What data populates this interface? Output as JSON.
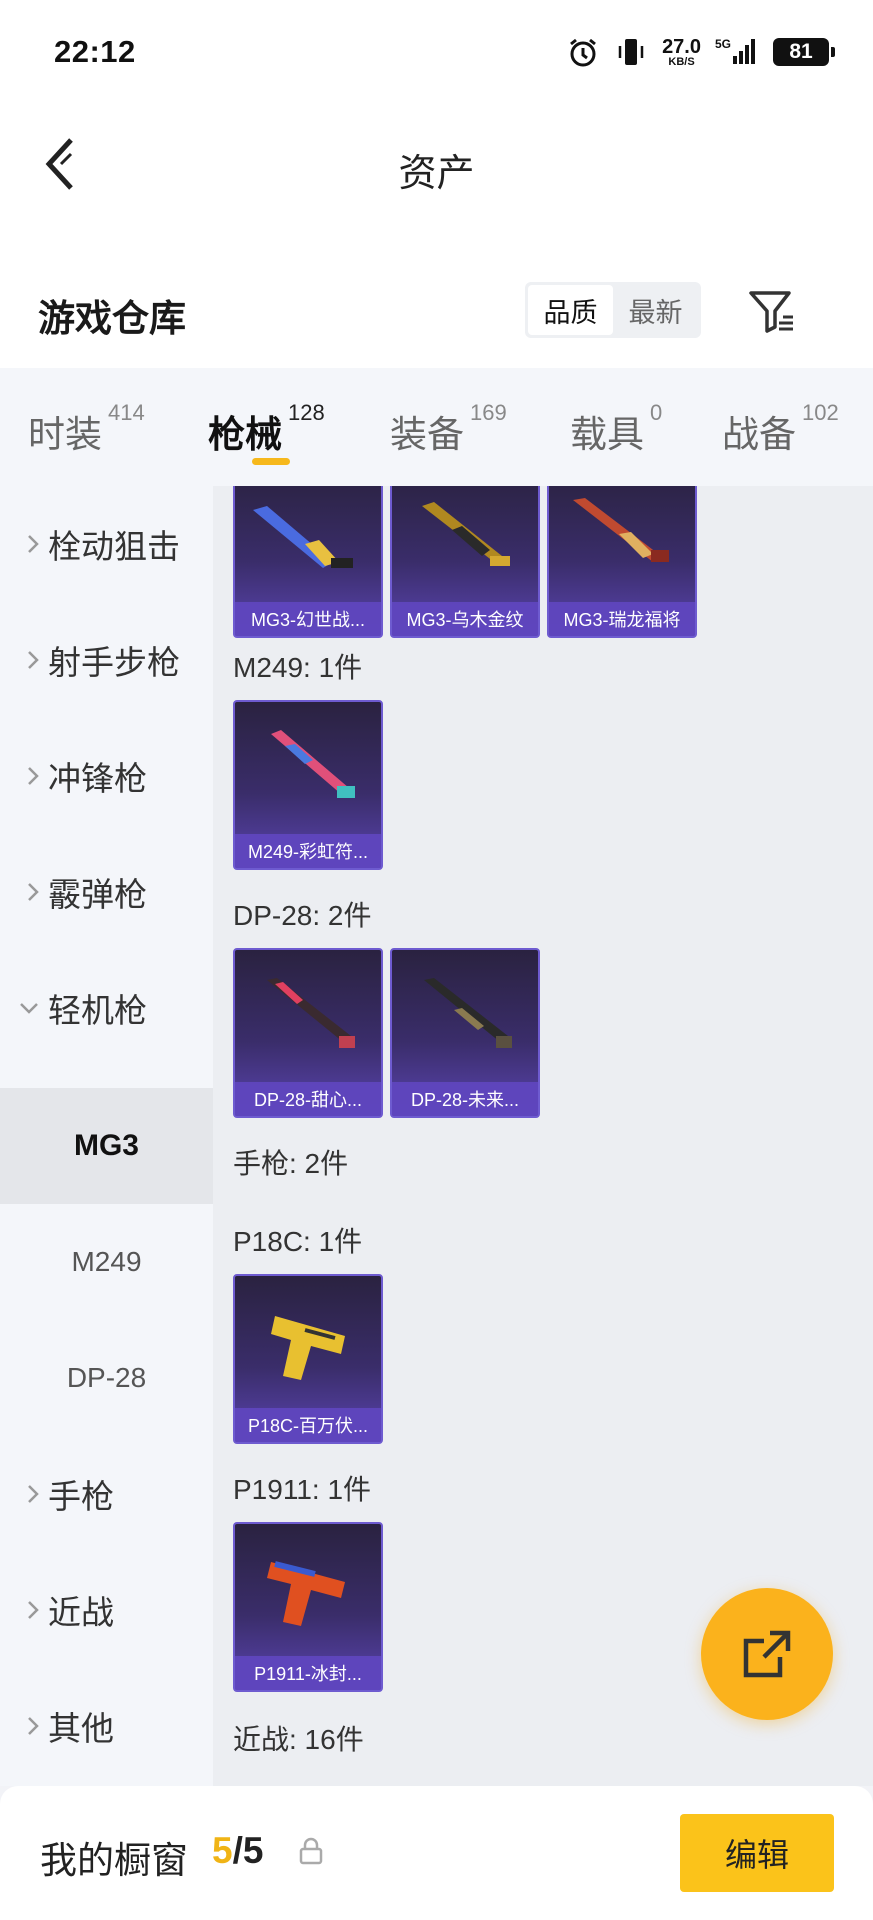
{
  "status_bar": {
    "time": "22:12",
    "speed_value": "27.0",
    "speed_unit": "KB/S",
    "network": "5G",
    "battery": "81"
  },
  "header": {
    "title": "资产"
  },
  "warehouse": {
    "title": "游戏仓库",
    "sort_options": [
      "品质",
      "最新"
    ],
    "active_sort": "品质"
  },
  "tabs": [
    {
      "label": "时装",
      "count": "414"
    },
    {
      "label": "枪械",
      "count": "128"
    },
    {
      "label": "装备",
      "count": "169"
    },
    {
      "label": "载具",
      "count": "0"
    },
    {
      "label": "战备",
      "count": "102"
    }
  ],
  "active_tab": "枪械",
  "sidebar": {
    "items": [
      "栓动狙击",
      "射手步枪",
      "冲锋枪",
      "霰弹枪",
      "轻机枪"
    ],
    "expanded": "轻机枪",
    "sub_items": [
      "MG3",
      "M249",
      "DP-28"
    ],
    "active_sub": "MG3",
    "items_after": [
      "手枪",
      "近战",
      "其他"
    ]
  },
  "content": {
    "top_row": [
      "MG3-幻世战...",
      "MG3-乌木金纹",
      "MG3-瑞龙福将"
    ],
    "groups": [
      {
        "label": "M249: 1件",
        "items": [
          "M249-彩虹符..."
        ]
      },
      {
        "label": "DP-28: 2件",
        "items": [
          "DP-28-甜心...",
          "DP-28-未来..."
        ]
      },
      {
        "label": "手枪: 2件",
        "items": []
      },
      {
        "label": "P18C: 1件",
        "items": [
          "P18C-百万伏..."
        ]
      },
      {
        "label": "P1911: 1件",
        "items": [
          "P1911-冰封..."
        ]
      },
      {
        "label": "近战: 16件",
        "items": []
      }
    ]
  },
  "bottom_bar": {
    "label": "我的橱窗",
    "current": "5",
    "separator": "/",
    "max": "5",
    "edit_label": "编辑"
  },
  "colors": {
    "accent": "#fbb21c",
    "card_purple": "#5a44b0"
  }
}
